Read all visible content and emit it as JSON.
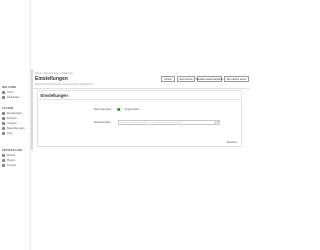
{
  "sidebar": {
    "groups": [
      {
        "label": "WELCOME",
        "items": [
          {
            "label": "Home",
            "icon": "home-icon"
          },
          {
            "label": "Dashboard",
            "icon": "dashboard-icon"
          }
        ]
      },
      {
        "label": "SYSTEM",
        "items": [
          {
            "label": "Einstellungen",
            "icon": "settings-icon"
          },
          {
            "label": "Benutzer",
            "icon": "users-icon"
          },
          {
            "label": "Gruppen",
            "icon": "groups-icon"
          },
          {
            "label": "Berechtigungen",
            "icon": "permissions-icon"
          },
          {
            "label": "Logs",
            "icon": "logs-icon"
          }
        ]
      },
      {
        "label": "ENTWICKLUNG",
        "items": [
          {
            "label": "Module",
            "icon": "modules-icon"
          },
          {
            "label": "Plugins",
            "icon": "plugins-icon"
          },
          {
            "label": "Themes",
            "icon": "themes-icon"
          }
        ]
      }
    ]
  },
  "header": {
    "breadcrumb": "Home / Einstellungen / Allgemein",
    "title": "Einstellungen",
    "subtitle": "Allgemeine Einstellungen der Anwendung konfigurieren",
    "buttons": [
      "Zurück",
      "Übernehmen",
      "Standard wiederherstellen",
      "Alle Caches leeren"
    ]
  },
  "card": {
    "title": "Einstellungen",
    "toggle_label": "Wartungsmodus",
    "toggle_state": "Eingeschaltet",
    "toggle_on": true,
    "field_label": "Startseitenpfad",
    "field_value": "",
    "field_placeholder": "Pfad zur Startseite eingeben, z. B. /dashboard oder /home/index",
    "field_button": "⊕",
    "save_label": "Speichern"
  },
  "colors": {
    "accent": "#3b9a5b",
    "border": "#e3e3e3"
  }
}
